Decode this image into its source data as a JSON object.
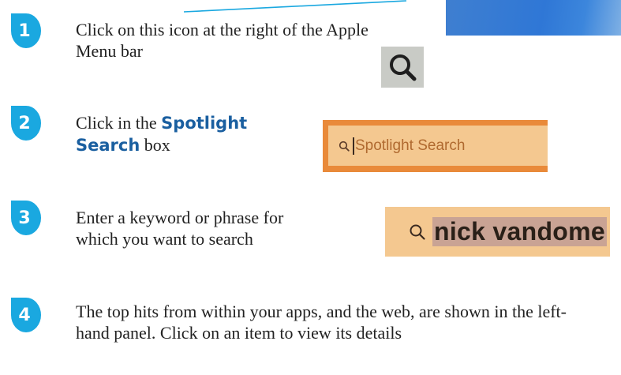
{
  "steps": [
    {
      "number": "1",
      "text": "Click on this icon at the right of the Apple Menu bar"
    },
    {
      "number": "2",
      "text_before": "Click in the ",
      "highlight": "Spotlight Search",
      "text_after": " box"
    },
    {
      "number": "3",
      "text": "Enter a keyword or phrase for which you want to search"
    },
    {
      "number": "4",
      "text": "The top hits from within your apps, and the web, are shown in the left-hand panel. Click on an item to view its details"
    }
  ],
  "spotlight_field": {
    "placeholder": "Spotlight Search"
  },
  "search_field": {
    "query": "nick vandome"
  },
  "colors": {
    "badge": "#1aa8e0",
    "highlight_text": "#1a5fa0",
    "field_border": "#e98a3a",
    "field_fill": "#f4c890"
  },
  "icons": {
    "magnifier": "magnifier-icon",
    "search": "search-icon"
  }
}
